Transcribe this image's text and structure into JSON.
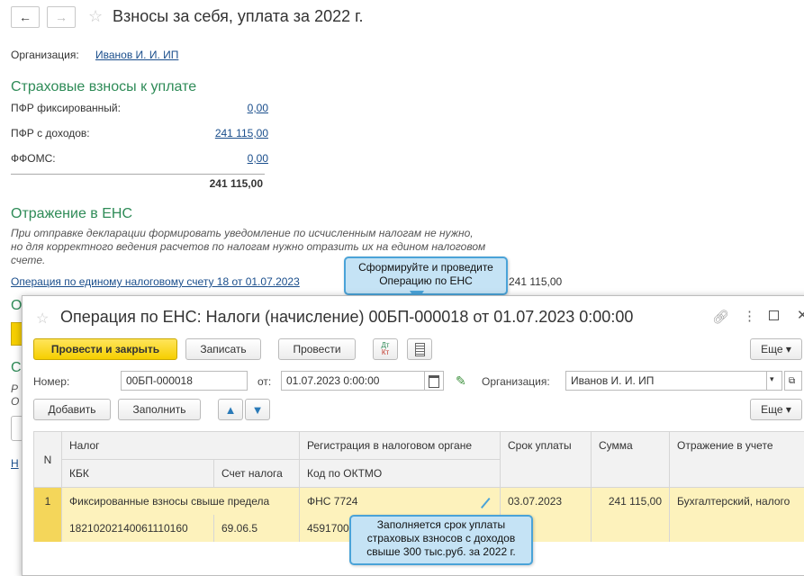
{
  "header": {
    "title": "Взносы за себя, уплата за 2022 г.",
    "back": "←",
    "forward": "→",
    "star": "☆"
  },
  "org": {
    "label": "Организация:",
    "value": "Иванов И. И. ИП"
  },
  "section1": {
    "title": "Страховые взносы к уплате",
    "rows": [
      {
        "label": "ПФР фиксированный:",
        "value": "0,00"
      },
      {
        "label": "ПФР с доходов:",
        "value": "241 115,00"
      },
      {
        "label": "ФФОМС:",
        "value": "0,00"
      }
    ],
    "total": "241 115,00"
  },
  "section2": {
    "title": "Отражение в ЕНС",
    "note_line1": "При отправке декларации формировать уведомление по исчисленным налогам не нужно,",
    "note_line2": "но для корректного ведения расчетов по налогам нужно отразить их на едином налоговом",
    "note_line3": "счете.",
    "operation_link": "Операция по единому налоговому счету 18 от 01.07.2023",
    "operation_sum": "241 115,00"
  },
  "callout_top": {
    "line1": "Сформируйте и проведите",
    "line2": "Операцию по ЕНС"
  },
  "callout_bottom": {
    "line1": "Заполняется срок уплаты",
    "line2": "страховых взносов с доходов",
    "line3": "свыше 300 тыс.руб. за 2022 г."
  },
  "modal": {
    "title": "Операция по ЕНС: Налоги (начисление) 00БП-000018 от 01.07.2023 0:00:00",
    "toolbar": {
      "post_close": "Провести и закрыть",
      "save": "Записать",
      "post": "Провести",
      "dtkt_top": "Дт",
      "dtkt_bottom": "Кт",
      "more": "Еще ▾"
    },
    "fields": {
      "number_label": "Номер:",
      "number_value": "00БП-000018",
      "date_label": "от:",
      "date_value": "01.07.2023  0:00:00",
      "org_label": "Организация:",
      "org_value": "Иванов И. И. ИП"
    },
    "table_toolbar": {
      "add": "Добавить",
      "fill": "Заполнить",
      "more": "Еще ▾"
    },
    "columns": {
      "n": "N",
      "tax": "Налог",
      "kbk": "КБК",
      "account": "Счет налога",
      "registration": "Регистрация в налоговом органе",
      "oktmo": "Код по ОКТМО",
      "due": "Срок уплаты",
      "sum": "Сумма",
      "reflection": "Отражение в учете"
    },
    "rows": [
      {
        "n": "1",
        "tax": "Фиксированные взносы свыше предела",
        "kbk": "18210202140061110160",
        "account": "69.06.5",
        "registration": "ФНС 7724",
        "oktmo": "4591700",
        "due": "03.07.2023",
        "sum": "241 115,00",
        "reflection": "Бухгалтерский, налого"
      }
    ]
  }
}
